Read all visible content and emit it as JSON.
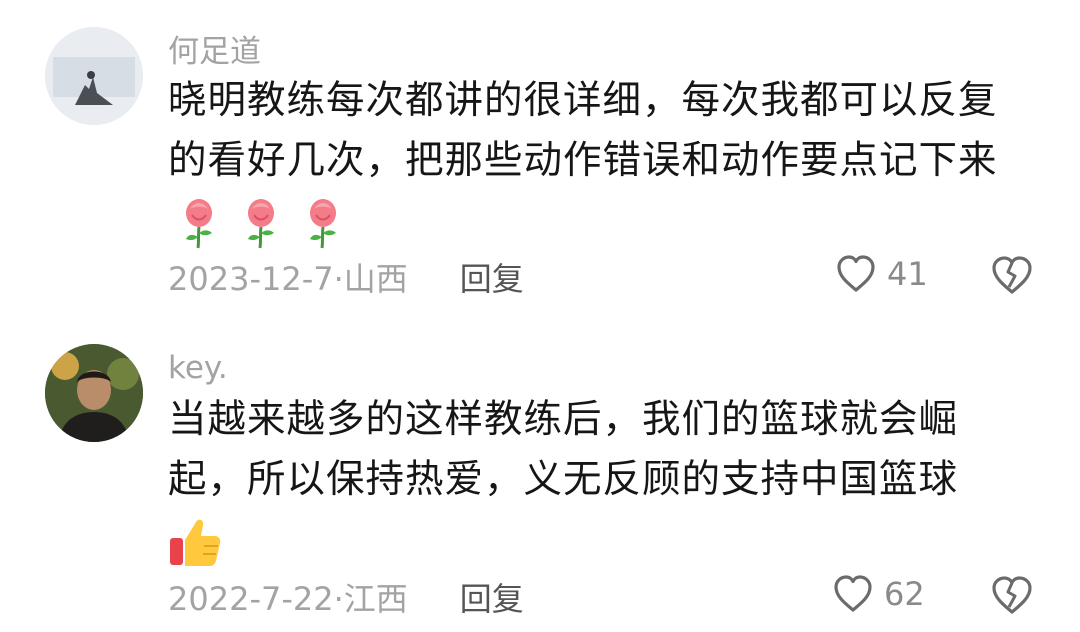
{
  "comments": [
    {
      "username": "何足道",
      "text": "晓明教练每次都讲的很详细，每次我都可以反复的看好几次，把那些动作错误和动作要点记下来",
      "emojis": [
        "rose-emoji",
        "rose-emoji",
        "rose-emoji"
      ],
      "date": "2023-12-7·山西",
      "reply_label": "回复",
      "likes": "41"
    },
    {
      "username": "key.",
      "text": "当越来越多的这样教练后，我们的篮球就会崛起，所以保持热爱，义无反顾的支持中国篮球",
      "emojis": [
        "thumbs-up-emoji"
      ],
      "date": "2022-7-22·江西",
      "reply_label": "回复",
      "likes": "62"
    }
  ]
}
